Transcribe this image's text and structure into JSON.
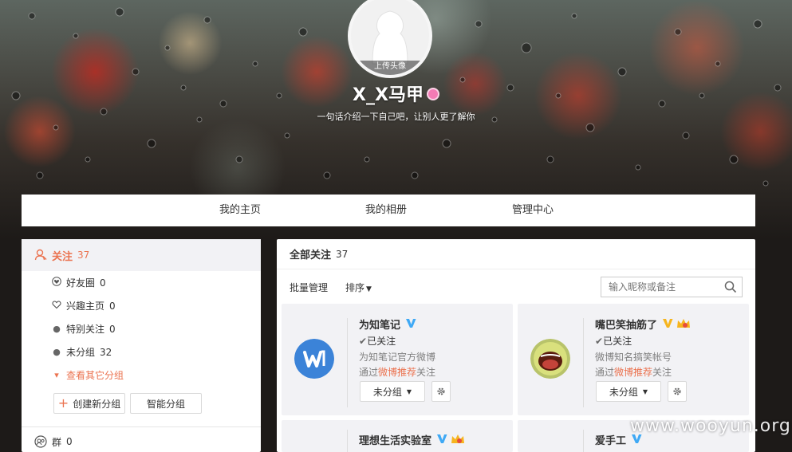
{
  "profile": {
    "avatar_upload_label": "上传头像",
    "username": "X_X马甲",
    "bio": "一句话介绍一下自己吧，让别人更了解你"
  },
  "tabs": [
    {
      "label": "我的主页"
    },
    {
      "label": "我的相册"
    },
    {
      "label": "管理中心"
    }
  ],
  "sidebar": {
    "follow": {
      "label": "关注",
      "count": "37"
    },
    "groups": [
      {
        "icon": "heart-circle-icon",
        "label": "好友圈",
        "count": "0"
      },
      {
        "icon": "heart-outline-icon",
        "label": "兴趣主页",
        "count": "0"
      },
      {
        "icon": "dot-icon",
        "label": "特别关注",
        "count": "0"
      },
      {
        "icon": "dot-icon",
        "label": "未分组",
        "count": "32"
      }
    ],
    "more_groups": "查看其它分组",
    "create_group_button": "创建新分组",
    "smart_group_button": "智能分组",
    "qun": {
      "label": "群",
      "count": "0"
    }
  },
  "main": {
    "title": "全部关注",
    "count": "37",
    "batch_manage": "批量管理",
    "sort": "排序",
    "search_placeholder": "输入昵称或备注",
    "cards": [
      {
        "name": "为知笔记",
        "status": "已关注",
        "desc": "为知笔记官方微博",
        "via_prefix": "通过",
        "via_link": "微博推荐",
        "via_suffix": "关注",
        "group_button": "未分组"
      },
      {
        "name": "嘴巴笑抽筋了",
        "status": "已关注",
        "desc": "微博知名搞笑帐号",
        "via_prefix": "通过",
        "via_link": "微博推荐",
        "via_suffix": "关注",
        "group_button": "未分组"
      },
      {
        "name": "理想生活实验室"
      },
      {
        "name": "爱手工"
      }
    ]
  },
  "watermark": "www.wooyun.org",
  "colors": {
    "accent": "#eb7350",
    "verified_blue": "#3fa9f5",
    "verified_gold": "#f6b51e",
    "panel_grey": "#f2f2f5"
  }
}
